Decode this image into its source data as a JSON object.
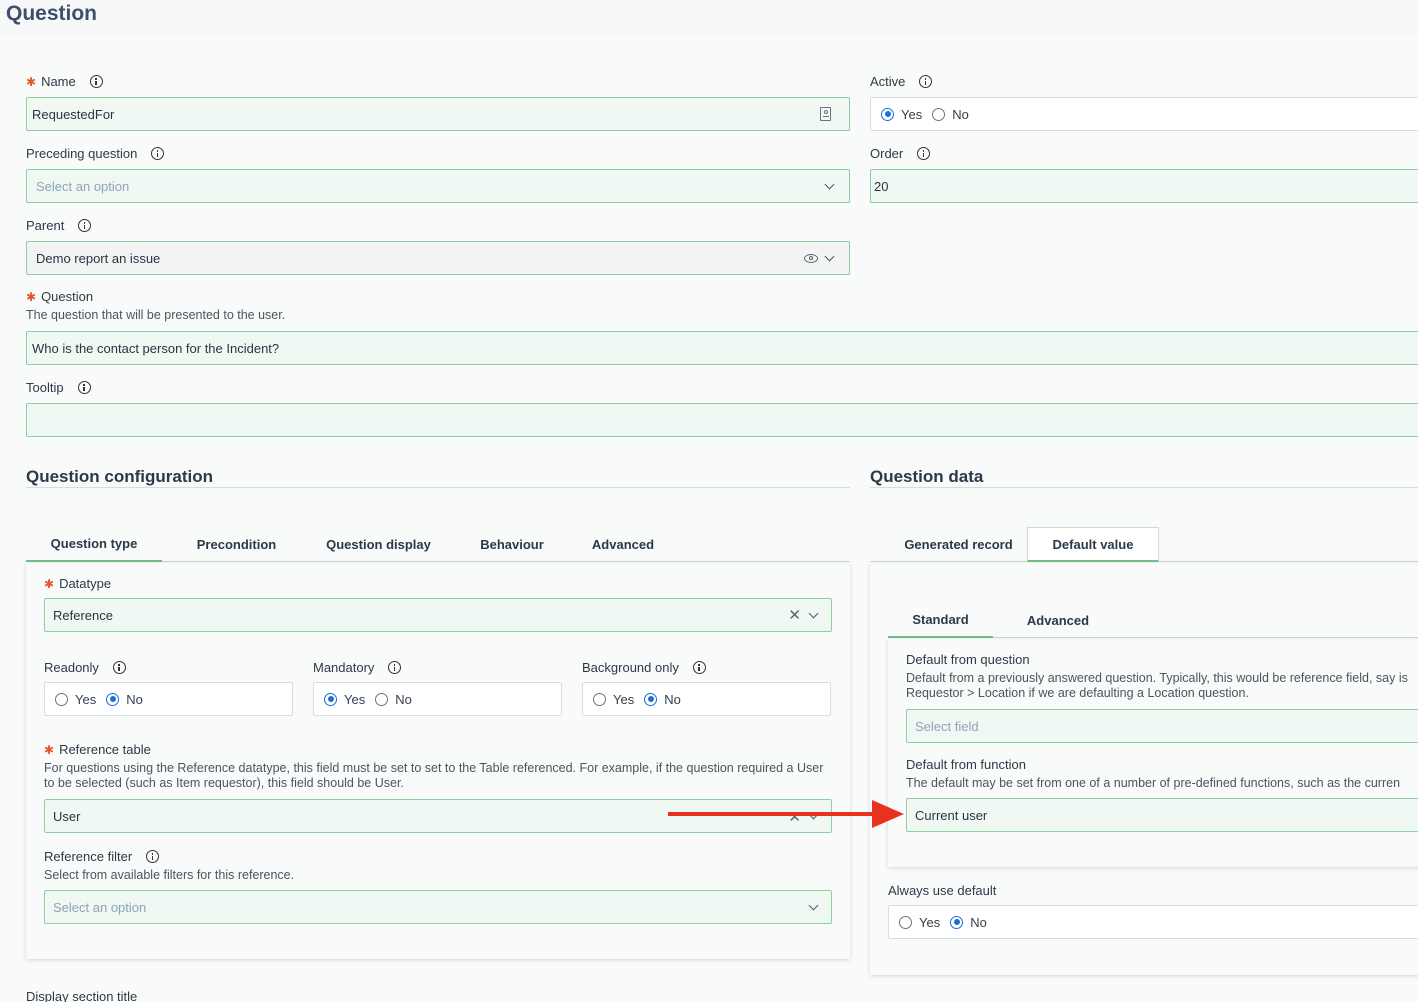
{
  "page": {
    "title": "Question"
  },
  "left": {
    "name": {
      "label": "Name",
      "value": "RequestedFor"
    },
    "preceding": {
      "label": "Preceding question",
      "placeholder": "Select an option"
    },
    "parent": {
      "label": "Parent",
      "value": "Demo report an issue"
    },
    "question": {
      "label": "Question",
      "description": "The question that will be presented to the user.",
      "value": "Who is the contact person for the Incident?"
    },
    "tooltip": {
      "label": "Tooltip",
      "value": ""
    }
  },
  "right": {
    "active": {
      "label": "Active",
      "yes": "Yes",
      "no": "No",
      "selected": "Yes"
    },
    "order": {
      "label": "Order",
      "value": "20"
    }
  },
  "config": {
    "title": "Question configuration",
    "tabs": [
      "Question type",
      "Precondition",
      "Question display",
      "Behaviour",
      "Advanced"
    ],
    "active_tab": "Question type",
    "datatype": {
      "label": "Datatype",
      "value": "Reference"
    },
    "readonly": {
      "label": "Readonly",
      "yes": "Yes",
      "no": "No",
      "selected": "No"
    },
    "mandatory": {
      "label": "Mandatory",
      "yes": "Yes",
      "no": "No",
      "selected": "Yes"
    },
    "background_only": {
      "label": "Background only",
      "yes": "Yes",
      "no": "No",
      "selected": "No"
    },
    "reference_table": {
      "label": "Reference table",
      "description": "For questions using the Reference datatype, this field must be set to set to the Table referenced. For example, if the question required a User to be selected (such as Item requestor), this field should be User.",
      "value": "User"
    },
    "reference_filter": {
      "label": "Reference filter",
      "description": "Select from available filters for this reference.",
      "placeholder": "Select an option"
    }
  },
  "data": {
    "title": "Question data",
    "tabs": [
      "Generated record",
      "Default value"
    ],
    "active_tab": "Default value",
    "subtabs": [
      "Standard",
      "Advanced"
    ],
    "active_subtab": "Standard",
    "default_from_question": {
      "label": "Default from question",
      "description": "Default from a previously answered question. Typically, this would be reference field, say is Requestor > Location if we are defaulting a Location question.",
      "placeholder": "Select field"
    },
    "default_from_function": {
      "label": "Default from function",
      "description": "The default may be set from one of a number of pre-defined functions, such as the curren",
      "value": "Current user"
    },
    "always_use_default": {
      "label": "Always use default",
      "yes": "Yes",
      "no": "No",
      "selected": "No"
    }
  },
  "footer": {
    "display_section_title": "Display section title"
  },
  "colors": {
    "accent": "#8fcf9f",
    "required": "#e4572e",
    "radio": "#1a6fd8",
    "arrow": "#e8321e"
  }
}
